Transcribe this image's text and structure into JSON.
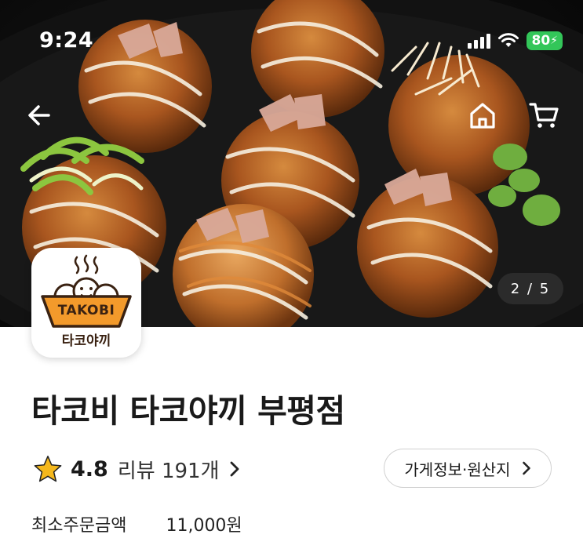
{
  "status_bar": {
    "time": "9:24",
    "battery": "80",
    "icons": [
      "signal-icon",
      "wifi-icon",
      "battery-charging-icon"
    ]
  },
  "hero": {
    "page_counter": "2 / 5",
    "nav_icons": [
      "back-arrow-icon",
      "home-icon",
      "cart-icon"
    ]
  },
  "logo": {
    "brand_en": "TAKOBI",
    "brand_ko": "타코야끼",
    "colors": {
      "orange": "#f39a2b",
      "brown": "#3a2212"
    }
  },
  "store": {
    "name": "타코비 타코야끼 부평점",
    "rating": "4.8",
    "review_label": "리뷰 191개",
    "info_button": "가게정보·원산지",
    "min_order_label": "최소주문금액",
    "min_order_value": "11,000원"
  },
  "colors": {
    "star": "#f5b81c",
    "battery": "#33c659",
    "text": "#1a1a1a"
  }
}
